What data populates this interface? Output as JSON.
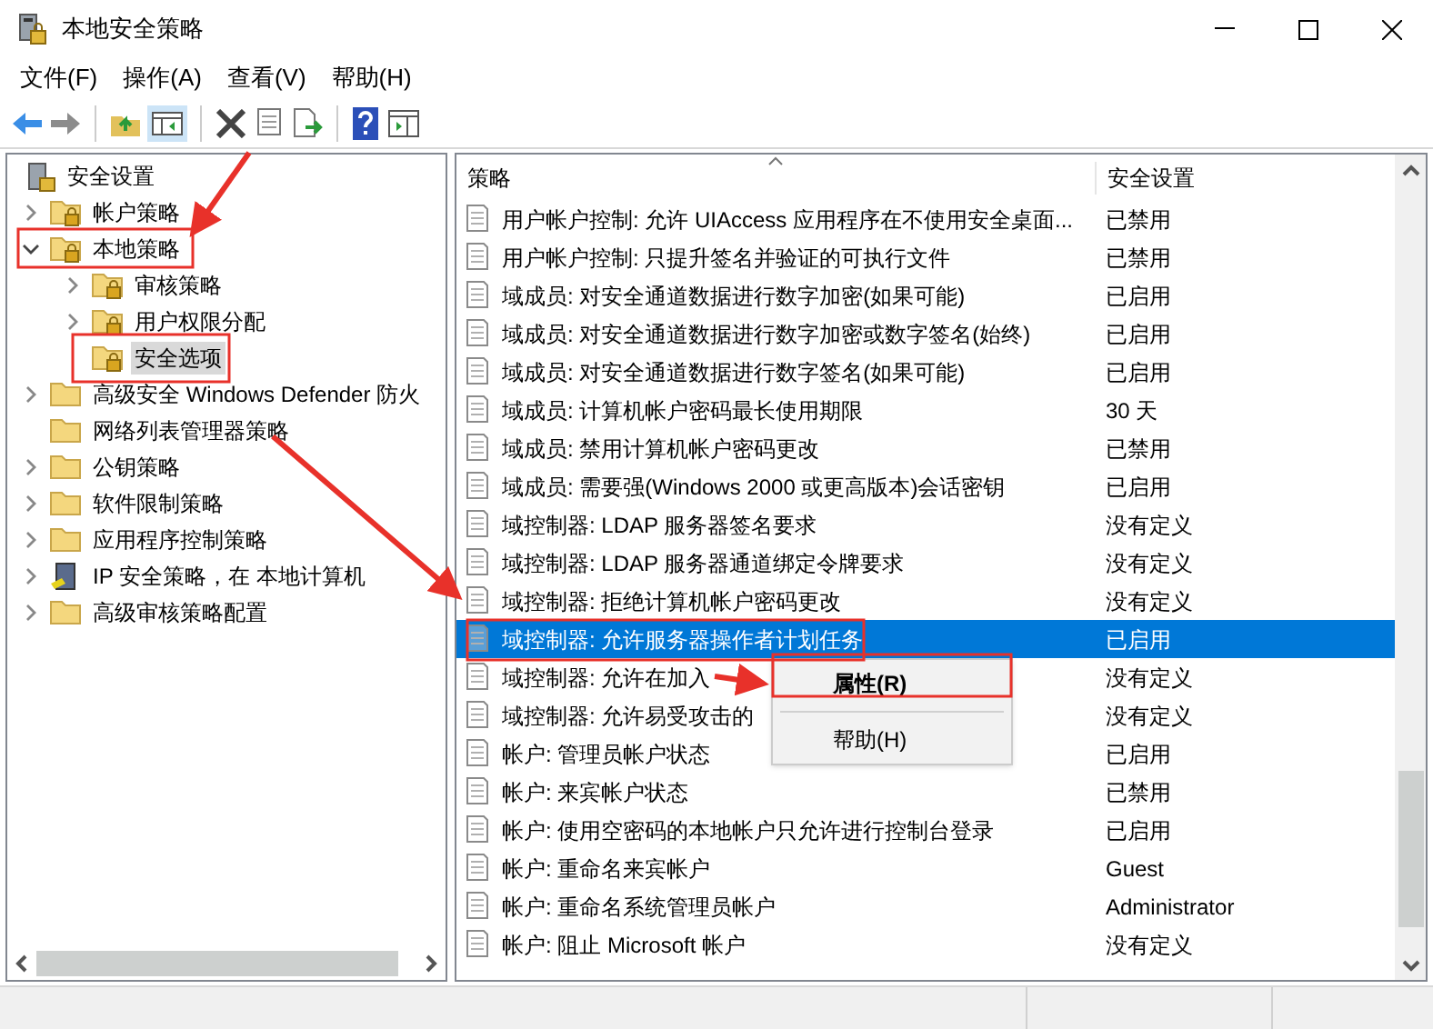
{
  "window": {
    "title": "本地安全策略"
  },
  "menu": [
    "文件(F)",
    "操作(A)",
    "查看(V)",
    "帮助(H)"
  ],
  "tree": {
    "label": "安全设置",
    "kind": "root",
    "selected": false,
    "children": [
      {
        "label": "帐户策略",
        "kind": "folder-lock",
        "expandable": true,
        "expanded": false,
        "selected": false
      },
      {
        "label": "本地策略",
        "kind": "folder-lock",
        "expandable": true,
        "expanded": true,
        "selected": false,
        "children": [
          {
            "label": "审核策略",
            "kind": "folder-lock",
            "expandable": true,
            "expanded": false,
            "selected": false
          },
          {
            "label": "用户权限分配",
            "kind": "folder-lock",
            "expandable": true,
            "expanded": false,
            "selected": false
          },
          {
            "label": "安全选项",
            "kind": "folder-lock",
            "expandable": false,
            "expanded": false,
            "selected": true
          }
        ]
      },
      {
        "label": "高级安全 Windows Defender 防火",
        "kind": "folder",
        "expandable": true,
        "expanded": false,
        "selected": false
      },
      {
        "label": "网络列表管理器策略",
        "kind": "folder",
        "expandable": false,
        "expanded": false,
        "selected": false
      },
      {
        "label": "公钥策略",
        "kind": "folder",
        "expandable": true,
        "expanded": false,
        "selected": false
      },
      {
        "label": "软件限制策略",
        "kind": "folder",
        "expandable": true,
        "expanded": false,
        "selected": false
      },
      {
        "label": "应用程序控制策略",
        "kind": "folder",
        "expandable": true,
        "expanded": false,
        "selected": false
      },
      {
        "label": "IP 安全策略，在 本地计算机",
        "kind": "computer",
        "expandable": true,
        "expanded": false,
        "selected": false
      },
      {
        "label": "高级审核策略配置",
        "kind": "folder",
        "expandable": true,
        "expanded": false,
        "selected": false
      }
    ]
  },
  "table": {
    "columns": [
      "策略",
      "安全设置"
    ],
    "rows": [
      {
        "policy": "用户帐户控制: 允许 UIAccess 应用程序在不使用安全桌面...",
        "setting": "已禁用",
        "selected": false
      },
      {
        "policy": "用户帐户控制: 只提升签名并验证的可执行文件",
        "setting": "已禁用",
        "selected": false
      },
      {
        "policy": "域成员: 对安全通道数据进行数字加密(如果可能)",
        "setting": "已启用",
        "selected": false
      },
      {
        "policy": "域成员: 对安全通道数据进行数字加密或数字签名(始终)",
        "setting": "已启用",
        "selected": false
      },
      {
        "policy": "域成员: 对安全通道数据进行数字签名(如果可能)",
        "setting": "已启用",
        "selected": false
      },
      {
        "policy": "域成员: 计算机帐户密码最长使用期限",
        "setting": "30 天",
        "selected": false
      },
      {
        "policy": "域成员: 禁用计算机帐户密码更改",
        "setting": "已禁用",
        "selected": false
      },
      {
        "policy": "域成员: 需要强(Windows 2000 或更高版本)会话密钥",
        "setting": "已启用",
        "selected": false
      },
      {
        "policy": "域控制器: LDAP 服务器签名要求",
        "setting": "没有定义",
        "selected": false
      },
      {
        "policy": "域控制器: LDAP 服务器通道绑定令牌要求",
        "setting": "没有定义",
        "selected": false
      },
      {
        "policy": "域控制器: 拒绝计算机帐户密码更改",
        "setting": "没有定义",
        "selected": false
      },
      {
        "policy": "域控制器: 允许服务器操作者计划任务",
        "setting": "已启用",
        "selected": true
      },
      {
        "policy": "域控制器:   允许在加入",
        "setting": "没有定义",
        "selected": false
      },
      {
        "policy": "域控制器: 允许易受攻击的",
        "setting": "没有定义",
        "selected": false
      },
      {
        "policy": "帐户: 管理员帐户状态",
        "setting": "已启用",
        "selected": false
      },
      {
        "policy": "帐户: 来宾帐户状态",
        "setting": "已禁用",
        "selected": false
      },
      {
        "policy": "帐户: 使用空密码的本地帐户只允许进行控制台登录",
        "setting": "已启用",
        "selected": false
      },
      {
        "policy": "帐户: 重命名来宾帐户",
        "setting": "Guest",
        "selected": false
      },
      {
        "policy": "帐户: 重命名系统管理员帐户",
        "setting": "Administrator",
        "selected": false
      },
      {
        "policy": "帐户: 阻止 Microsoft 帐户",
        "setting": "没有定义",
        "selected": false
      }
    ]
  },
  "context_menu": [
    {
      "label": "属性(R)",
      "kind": "default"
    },
    {
      "label": "帮助(H)",
      "kind": "normal"
    }
  ]
}
